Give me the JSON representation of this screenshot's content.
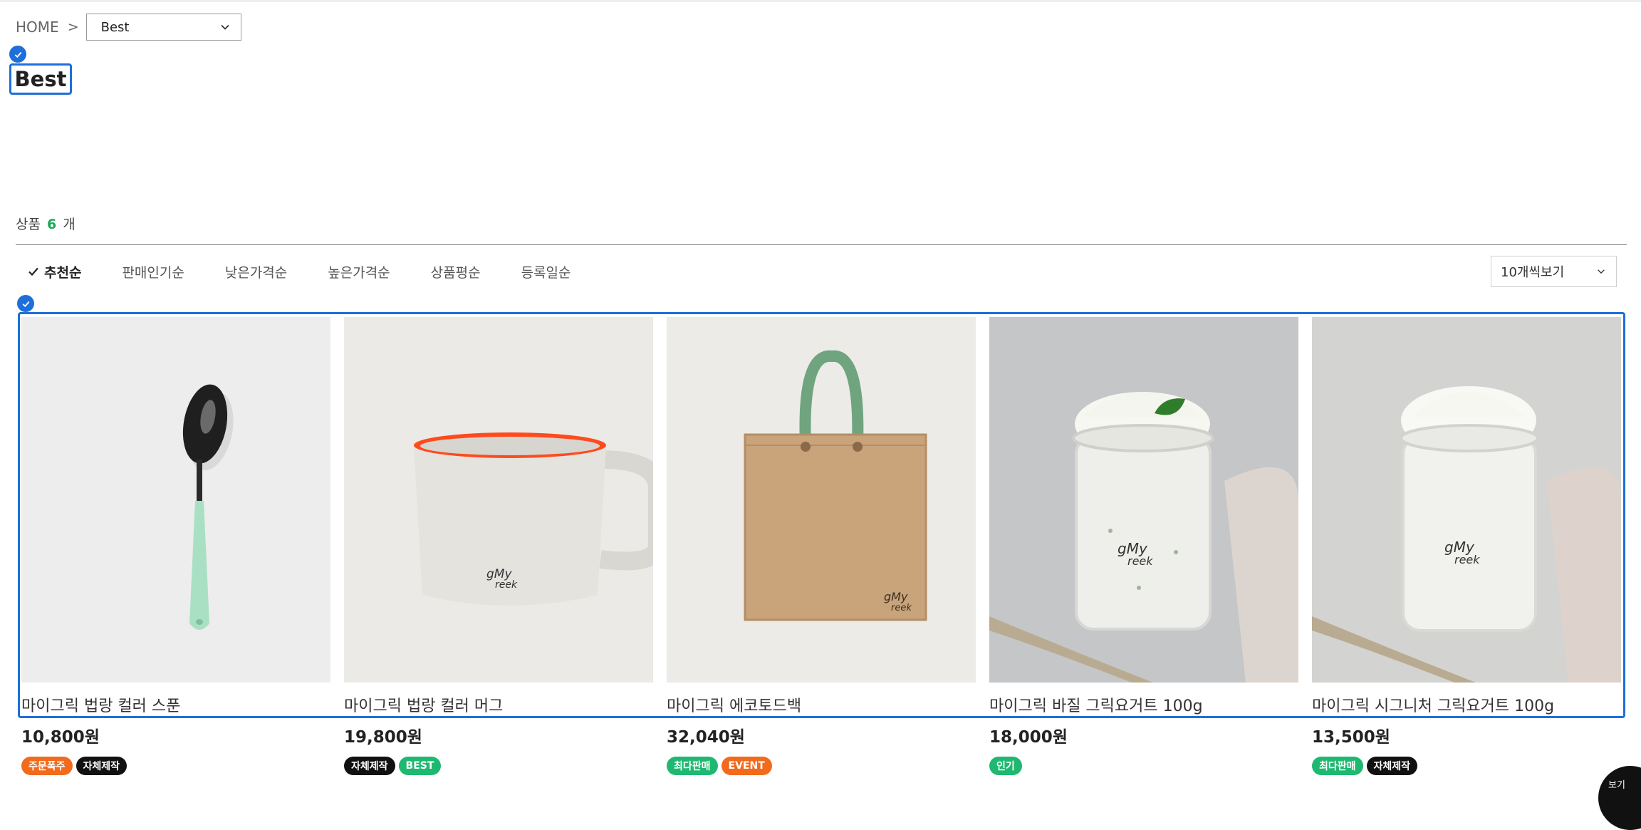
{
  "breadcrumb": {
    "home": "HOME",
    "separator": ">",
    "category": "Best"
  },
  "page": {
    "title": "Best"
  },
  "count": {
    "prefix": "상품",
    "number": "6",
    "suffix": "개"
  },
  "sort": {
    "options": [
      "추천순",
      "판매인기순",
      "낮은가격순",
      "높은가격순",
      "상품평순",
      "등록일순"
    ],
    "active": "추천순"
  },
  "view_select": {
    "label": "10개씩보기"
  },
  "colors": {
    "accent": "#1e6fd9",
    "count_green": "#1aa85a",
    "badge_orange": "#f26b1d",
    "badge_black": "#111111",
    "badge_green": "#1fb871"
  },
  "products": [
    {
      "name": "마이그릭 법랑 컬러 스푼",
      "price": "10,800원",
      "badges": [
        {
          "label": "주문폭주",
          "color": "#f26b1d"
        },
        {
          "label": "자체제작",
          "color": "#111111"
        }
      ]
    },
    {
      "name": "마이그릭 법랑 컬러 머그",
      "price": "19,800원",
      "badges": [
        {
          "label": "자체제작",
          "color": "#111111"
        },
        {
          "label": "BEST",
          "color": "#1fb871"
        }
      ]
    },
    {
      "name": "마이그릭 에코토드백",
      "price": "32,040원",
      "badges": [
        {
          "label": "최다판매",
          "color": "#1fb871"
        },
        {
          "label": "EVENT",
          "color": "#f26b1d"
        }
      ]
    },
    {
      "name": "마이그릭 바질 그릭요거트 100g",
      "price": "18,000원",
      "badges": [
        {
          "label": "인기",
          "color": "#1fb871"
        }
      ]
    },
    {
      "name": "마이그릭 시그니처 그릭요거트 100g",
      "price": "13,500원",
      "badges": [
        {
          "label": "최다판매",
          "color": "#1fb871"
        },
        {
          "label": "자체제작",
          "color": "#111111"
        }
      ]
    }
  ],
  "corner_button": {
    "label": "보기"
  }
}
